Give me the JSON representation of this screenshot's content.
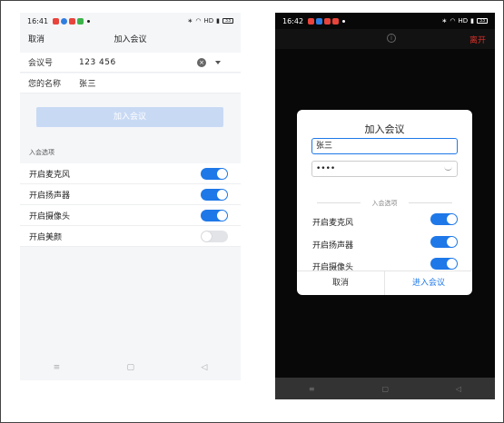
{
  "left": {
    "status": {
      "time": "16:41",
      "net": "HD",
      "battery": "33"
    },
    "header": {
      "cancel": "取消",
      "title": "加入会议"
    },
    "meeting_id": {
      "label": "会议号",
      "value": "123 456"
    },
    "name": {
      "label": "您的名称",
      "value": "张三"
    },
    "join_button": "加入会议",
    "section_label": "入会选项",
    "options": [
      {
        "label": "开启麦克风",
        "on": true
      },
      {
        "label": "开启扬声器",
        "on": true
      },
      {
        "label": "开启摄像头",
        "on": true
      },
      {
        "label": "开启美颜",
        "on": false
      }
    ]
  },
  "right": {
    "status": {
      "time": "16:42",
      "net": "HD",
      "battery": "33"
    },
    "leave": "离开",
    "dialog": {
      "title": "加入会议",
      "name_value": "张三",
      "password_value": "••••",
      "section_label": "入会选项",
      "options": [
        {
          "label": "开启麦克风",
          "on": true
        },
        {
          "label": "开启扬声器",
          "on": true
        },
        {
          "label": "开启摄像头",
          "on": true
        }
      ],
      "cancel": "取消",
      "confirm": "进入会议"
    }
  },
  "colors": {
    "accent": "#1e78e8",
    "danger": "#d5312b",
    "disabled": "#c8d9f4"
  }
}
